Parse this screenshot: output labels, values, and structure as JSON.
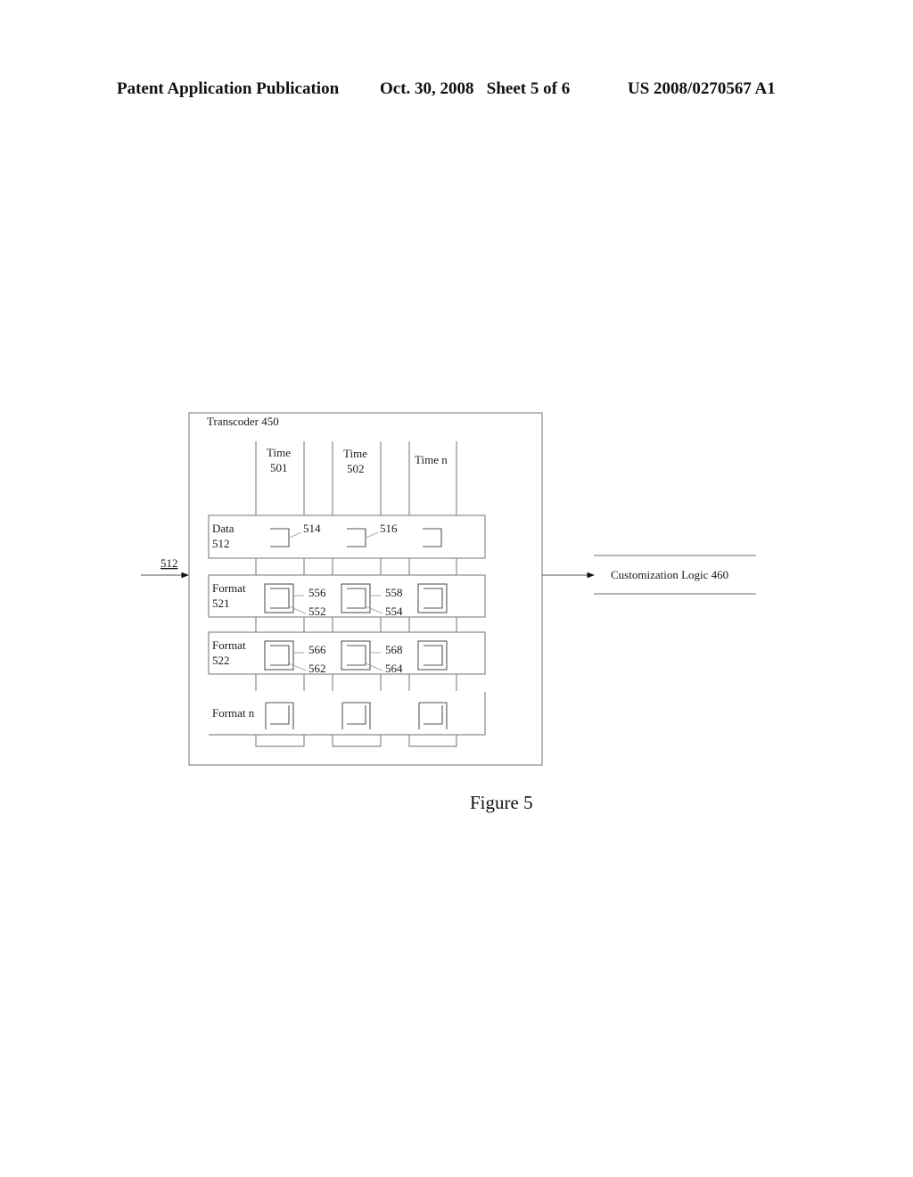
{
  "header": {
    "publication": "Patent Application Publication",
    "date_sheet": "Oct. 30, 2008   Sheet 5 of 6",
    "number": "US 2008/0270567 A1"
  },
  "figure": {
    "caption": "Figure 5",
    "transcoder_label": "Transcoder 450",
    "input_label": "512",
    "output_label": "Customization Logic 460",
    "time_columns": [
      {
        "line1": "Time",
        "line2": "501"
      },
      {
        "line1": "Time",
        "line2": "502"
      },
      {
        "line1": "Time n",
        "line2": ""
      }
    ],
    "rows": [
      {
        "line1": "Data",
        "line2": "512"
      },
      {
        "line1": "Format",
        "line2": "521"
      },
      {
        "line1": "Format",
        "line2": "522"
      },
      {
        "line1": "Format n",
        "line2": ""
      }
    ],
    "callouts": {
      "data_col1": "514",
      "data_col2": "516",
      "f521_col1_outer": "556",
      "f521_col1_inner": "552",
      "f521_col2_outer": "558",
      "f521_col2_inner": "554",
      "f522_col1_outer": "566",
      "f522_col1_inner": "562",
      "f522_col2_outer": "568",
      "f522_col2_inner": "564"
    }
  }
}
